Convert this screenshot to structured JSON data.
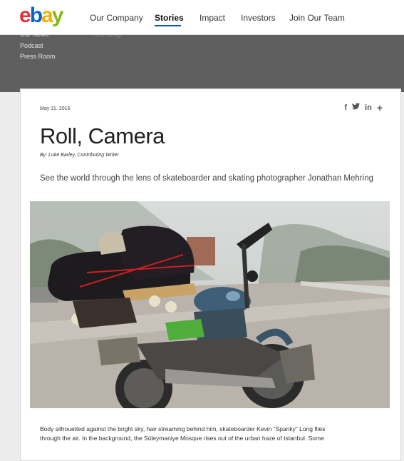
{
  "brand": {
    "letters": [
      "e",
      "b",
      "a",
      "y"
    ]
  },
  "nav": {
    "items": [
      {
        "label": "Our Company",
        "active": false
      },
      {
        "label": "Stories",
        "active": true
      },
      {
        "label": "Impact",
        "active": false
      },
      {
        "label": "Investors",
        "active": false
      },
      {
        "label": "Join Our Team",
        "active": false
      }
    ]
  },
  "subnav": {
    "links": [
      "Our News",
      "Podcast",
      "Press Room",
      "Tech Blog"
    ]
  },
  "article": {
    "date": "May 31, 2016",
    "share_icons": [
      "facebook-icon",
      "twitter-icon",
      "linkedin-icon",
      "plus-icon"
    ],
    "share_glyphs": [
      "f",
      "𝕥",
      "in",
      "+"
    ],
    "title": "Roll, Camera",
    "byline": "By: Luke Barley, Contributing Writer",
    "subtitle": "See the world through the lens of skateboarder and skating photographer Jonathan Mehring",
    "body_line_1": "Body silhouetted against the bright sky, hair streaming behind him, skateboarder Kevin “Spanky” Long flies",
    "body_line_2": "through the air. In the background, the Süleymaniye Mosque rises out of the urban haze of Istanbul. Some"
  },
  "colors": {
    "ebay_red": "#e53238",
    "ebay_blue": "#0064d2",
    "ebay_yellow": "#f5af02",
    "ebay_green": "#86b817",
    "nav_underline": "#0654ba",
    "subnav_bg": "#5f5f5f"
  }
}
